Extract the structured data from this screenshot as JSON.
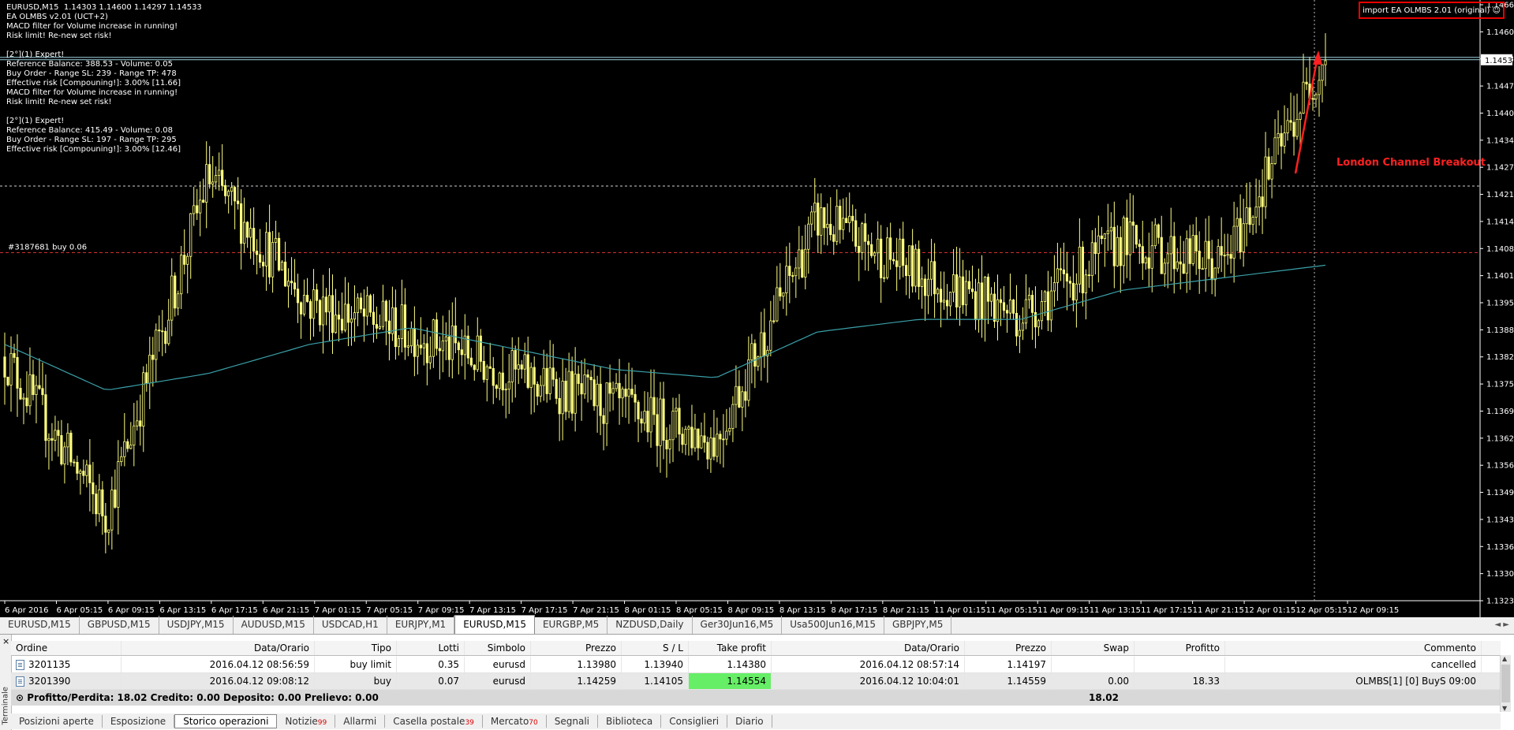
{
  "chart": {
    "symbol_info": "EURUSD,M15  1.14303 1.14600 1.14297 1.14533",
    "info_lines": [
      "EA OLMBS v2.01 (UCT+2)",
      "MACD filter for Volume increase in running!",
      "Risk limit! Re-new set risk!",
      "",
      "[2°](1) Expert!",
      "Reference Balance: 388.53 - Volume: 0.05",
      "Buy Order - Range SL: 239 - Range TP: 478",
      "Effective risk [Compouning!]: 3.00% [11.66]",
      "MACD filter for Volume increase in running!",
      "Risk limit! Re-new set risk!",
      "",
      "[2°](1) Expert!",
      "Reference Balance: 415.49 - Volume: 0.08",
      "Buy Order - Range SL: 197 - Range TP: 295",
      "Effective risk [Compouning!]: 3.00% [12.46]"
    ],
    "ea_badge": "import EA OLMBS 2.01 (original) ☺",
    "order_line_label": "#3187681 buy 0.06",
    "annotation": "London Channel Breakout",
    "current_price": "1.14533",
    "y_ticks": [
      "1.14665",
      "1.14600",
      "1.14535",
      "1.14470",
      "1.14405",
      "1.14340",
      "1.14275",
      "1.14210",
      "1.14145",
      "1.14080",
      "1.14015",
      "1.13950",
      "1.13885",
      "1.13820",
      "1.13755",
      "1.13690",
      "1.13625",
      "1.13560",
      "1.13495",
      "1.13430",
      "1.13365",
      "1.13300",
      "1.13235"
    ],
    "x_ticks": [
      "6 Apr 2016",
      "6 Apr 05:15",
      "6 Apr 09:15",
      "6 Apr 13:15",
      "6 Apr 17:15",
      "6 Apr 21:15",
      "7 Apr 01:15",
      "7 Apr 05:15",
      "7 Apr 09:15",
      "7 Apr 13:15",
      "7 Apr 17:15",
      "7 Apr 21:15",
      "8 Apr 01:15",
      "8 Apr 05:15",
      "8 Apr 09:15",
      "8 Apr 13:15",
      "8 Apr 17:15",
      "8 Apr 21:15",
      "11 Apr 01:15",
      "11 Apr 05:15",
      "11 Apr 09:15",
      "11 Apr 13:15",
      "11 Apr 17:15",
      "11 Apr 21:15",
      "12 Apr 01:15",
      "12 Apr 05:15",
      "12 Apr 09:15"
    ],
    "colors": {
      "background": "#000000",
      "candles": "#ffff80",
      "moving_average": "#3aa0a8",
      "price_line": "#9ed4e0",
      "order_line": "#d03030",
      "annotation": "#ff2020"
    }
  },
  "chart_data": {
    "type": "line",
    "xlabel": "",
    "ylabel": "",
    "ylim": [
      1.13235,
      1.14665
    ],
    "x": [
      "6 Apr 2016",
      "6 Apr 09:15",
      "6 Apr 17:15",
      "7 Apr 01:15",
      "7 Apr 09:15",
      "7 Apr 17:15",
      "8 Apr 01:15",
      "8 Apr 09:15",
      "8 Apr 17:15",
      "11 Apr 01:15",
      "11 Apr 09:15",
      "11 Apr 17:15",
      "12 Apr 01:15",
      "12 Apr 09:15"
    ],
    "series": [
      {
        "values": [
          1.1382,
          1.1344,
          1.1425,
          1.1395,
          1.1388,
          1.1378,
          1.137,
          1.1362,
          1.1415,
          1.1402,
          1.1392,
          1.141,
          1.1404,
          1.1455
        ]
      },
      {
        "values": [
          1.1385,
          1.1374,
          1.1378,
          1.1385,
          1.1389,
          1.1384,
          1.1379,
          1.1377,
          1.1388,
          1.1391,
          1.1391,
          1.1398,
          1.1401,
          1.1404
        ]
      }
    ],
    "hlines": [
      1.14533,
      1.1423,
      1.1407
    ],
    "grid": false
  },
  "symbol_tabs": [
    {
      "label": "EURUSD,M15",
      "active": false
    },
    {
      "label": "GBPUSD,M15",
      "active": false
    },
    {
      "label": "USDJPY,M15",
      "active": false
    },
    {
      "label": "AUDUSD,M15",
      "active": false
    },
    {
      "label": "USDCAD,H1",
      "active": false
    },
    {
      "label": "EURJPY,M1",
      "active": false
    },
    {
      "label": "EURUSD,M15",
      "active": true
    },
    {
      "label": "EURGBP,M5",
      "active": false
    },
    {
      "label": "NZDUSD,Daily",
      "active": false
    },
    {
      "label": "Ger30Jun16,M5",
      "active": false
    },
    {
      "label": "Usa500Jun16,M15",
      "active": false
    },
    {
      "label": "GBPJPY,M5",
      "active": false
    }
  ],
  "terminal": {
    "side_label": "Terminale",
    "close": "×",
    "columns": [
      "Ordine",
      "Data/Orario",
      "Tipo",
      "Lotti",
      "Simbolo",
      "Prezzo",
      "S / L",
      "Take profit",
      "Data/Orario",
      "Prezzo",
      "Swap",
      "Profitto",
      "Commento"
    ],
    "rows": [
      [
        "3201135",
        "2016.04.12 08:56:59",
        "buy limit",
        "0.35",
        "eurusd",
        "1.13980",
        "1.13940",
        "1.14380",
        "2016.04.12 08:57:14",
        "1.14197",
        "",
        "",
        "cancelled"
      ],
      [
        "3201390",
        "2016.04.12 09:08:12",
        "buy",
        "0.07",
        "eurusd",
        "1.14259",
        "1.14105",
        "1.14554",
        "2016.04.12 10:04:01",
        "1.14559",
        "0.00",
        "18.33",
        "OLMBS[1] [0] BuyS 09:00"
      ]
    ],
    "summary": "Profitto/Perdita: 18.02  Credito: 0.00  Deposito: 0.00  Prelievo: 0.00",
    "summary_total": "18.02",
    "tabs": [
      {
        "label": "Posizioni aperte",
        "badge": "",
        "active": false
      },
      {
        "label": "Esposizione",
        "badge": "",
        "active": false
      },
      {
        "label": "Storico operazioni",
        "badge": "",
        "active": true
      },
      {
        "label": "Notizie",
        "badge": "99",
        "active": false
      },
      {
        "label": "Allarmi",
        "badge": "",
        "active": false
      },
      {
        "label": "Casella postale",
        "badge": "39",
        "active": false
      },
      {
        "label": "Mercato",
        "badge": "70",
        "active": false
      },
      {
        "label": "Segnali",
        "badge": "",
        "active": false
      },
      {
        "label": "Biblioteca",
        "badge": "",
        "active": false
      },
      {
        "label": "Consiglieri",
        "badge": "",
        "active": false
      },
      {
        "label": "Diario",
        "badge": "",
        "active": false
      }
    ]
  }
}
